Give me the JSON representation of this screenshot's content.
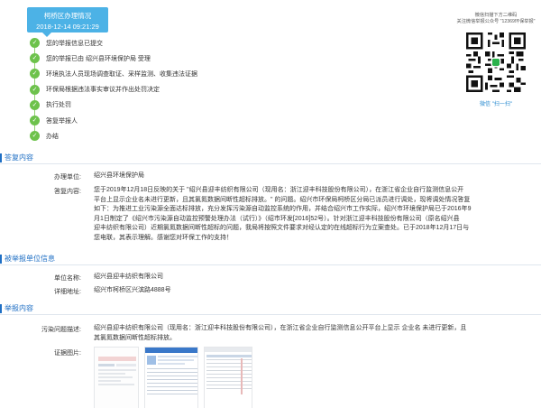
{
  "status_badge": {
    "title": "柯桥区办理情况",
    "datetime": "2018-12-14 09:21:29"
  },
  "timeline": [
    {
      "text": "您的举报信息已提交"
    },
    {
      "text": "您的举报已由 绍兴县环境保护局 受理"
    },
    {
      "text": "环境执法人员现场调查取证、采样监测、收集违法证据"
    },
    {
      "text": "环保局根据违法事实审议并作出处罚决定"
    },
    {
      "text": "执行处罚"
    },
    {
      "text": "答复举报人"
    },
    {
      "text": "办结"
    }
  ],
  "qr": {
    "line1": "微信扫描下方二维码",
    "line2": "关注微信举报公众号 \"12369环保举报\"",
    "caption": "微信 \"扫一扫\""
  },
  "reply": {
    "section_title": "答复内容",
    "unit_label": "办理单位:",
    "unit_value": "绍兴县环境保护局",
    "content_label": "答复内容:",
    "content_lines": [
      "您于2019年12月18日反映的关于 \"绍兴县迎丰纺织有限公司（现用名：浙江迎丰科技股份有限公司），在浙江省企业自行监测信息公开",
      "平台上显示企业名未进行更新，且其氯氮数据间断性超标排放。\" 的问题。绍兴市环保局柯桥区分局已派员进行调处，现将调处情况答复",
      "如下：为推进工业污染源全面达标排放，充分发挥污染源自动监控系统的作用，并结合绍兴市工作实际，绍兴市环境保护局已于2016年9",
      "月1日制定了《绍兴市污染源自动监控预警处理办法（试行）》（绍市环发[2016]52号）。针对浙江迎丰科技股份有限公司（原名绍兴县",
      "迎丰纺织有限公司）近期氯氮数据间断性超标的问题，我局将按照文件要求对经认定的在线超标行为立案查处。已于2018年12月17日与",
      "您电联，其表示理解。感谢您对环保工作的支持！"
    ]
  },
  "reported_unit": {
    "section_title": "被举报单位信息",
    "name_label": "单位名称:",
    "name_value": "绍兴县迎丰纺织有限公司",
    "addr_label": "详细地址:",
    "addr_value": "绍兴市柯桥区兴滨路4888号"
  },
  "report": {
    "section_title": "举报内容",
    "desc_label": "污染问题描述:",
    "desc_lines": [
      "绍兴县迎丰纺织有限公司（现用名：浙江迎丰科技股份有限公司），在浙江省企业自行监测信息公开平台上显示 企业名 未进行更新，且",
      "其氯氮数据间断性超标排放。"
    ],
    "images_label": "证据图片:"
  },
  "colors": {
    "accent": "#1f6fc4",
    "badge": "#4cb2e6",
    "timeline_green": "#6dc24b"
  }
}
